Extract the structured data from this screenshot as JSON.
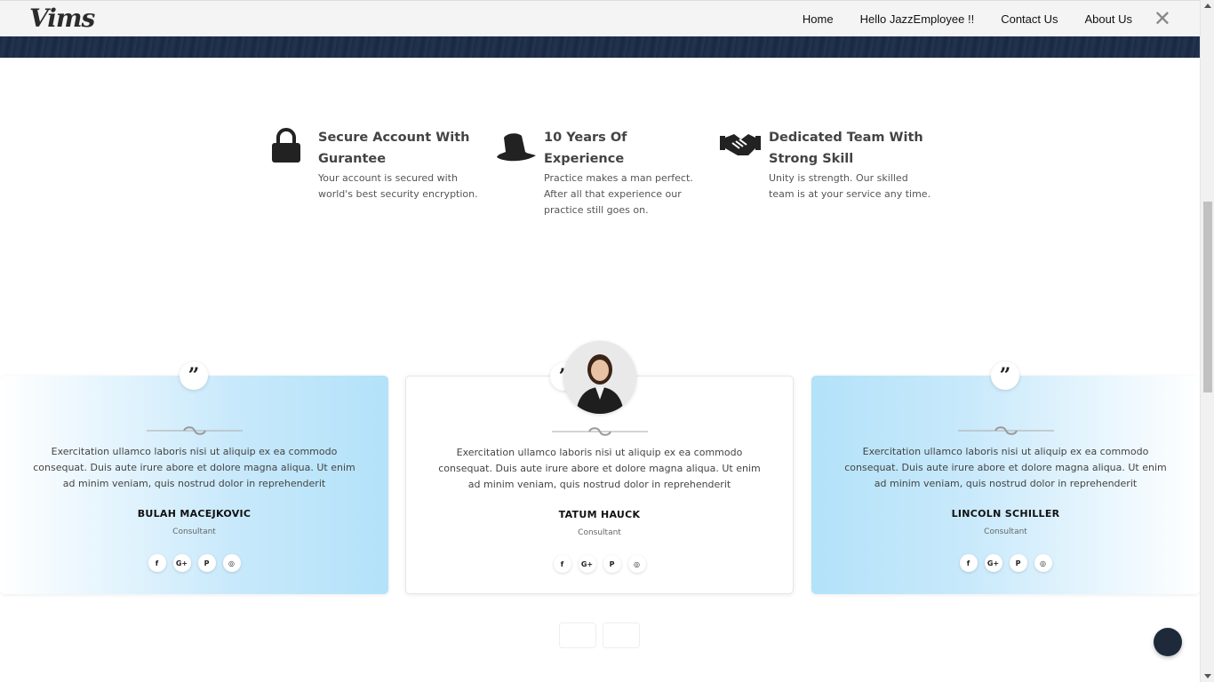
{
  "header": {
    "logo": "Vims",
    "nav": [
      "Home",
      "Hello JazzEmployee !!",
      "Contact Us",
      "About Us"
    ],
    "close_label": "✕"
  },
  "features": [
    {
      "icon": "lock-icon",
      "title": "Secure Account With Gurantee",
      "desc": "Your account is secured with world's best security encryption."
    },
    {
      "icon": "cowboy-hat-icon",
      "title": "10 Years Of Experience",
      "desc": "Practice makes a man perfect. After all that experience our practice still goes on."
    },
    {
      "icon": "handshake-icon",
      "title": "Dedicated Team With Strong Skill",
      "desc": "Unity is strength. Our skilled team is at your service any time."
    }
  ],
  "testimonials": [
    {
      "text": "Exercitation ullamco laboris nisi ut aliquip ex ea commodo consequat. Duis aute irure abore et dolore magna aliqua. Ut enim ad minim veniam, quis nostrud dolor in reprehenderit",
      "name": "BULAH MACEJKOVIC",
      "role": "Consultant",
      "quote": "”"
    },
    {
      "text": "Exercitation ullamco laboris nisi ut aliquip ex ea commodo consequat. Duis aute irure abore et dolore magna aliqua. Ut enim ad minim veniam, quis nostrud dolor in reprehenderit",
      "name": "TATUM HAUCK",
      "role": "Consultant",
      "quote": "”"
    },
    {
      "text": "Exercitation ullamco laboris nisi ut aliquip ex ea commodo consequat. Duis aute irure abore et dolore magna aliqua. Ut enim ad minim veniam, quis nostrud dolor in reprehenderit",
      "name": "LINCOLN SCHILLER",
      "role": "Consultant",
      "quote": "”"
    }
  ],
  "social_icons": [
    "facebook-icon",
    "google-plus-icon",
    "pinterest-icon",
    "instagram-icon"
  ],
  "social_glyphs": [
    "f",
    "G+",
    "P",
    "◎"
  ],
  "colors": {
    "dark_navy": "#1c2a44",
    "card_blue": "#b3e2f9",
    "chat_button": "#1e2a3a"
  }
}
